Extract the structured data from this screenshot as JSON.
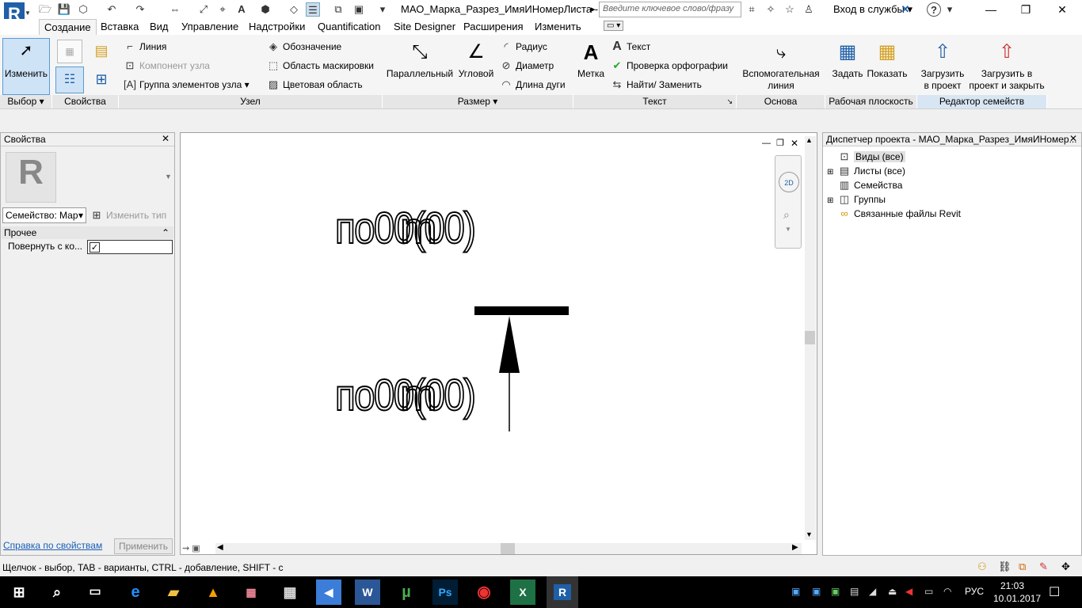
{
  "titlebar": {
    "doc_title": "МАО_Марка_Разрез_ИмяИНомерЛиста -...",
    "search_placeholder": "Введите ключевое слово/фразу",
    "login_label": "Вход в службы"
  },
  "tabs": [
    "Создание",
    "Вставка",
    "Вид",
    "Управление",
    "Надстройки",
    "Quantification",
    "Site Designer",
    "Расширения",
    "Изменить"
  ],
  "ribbon": {
    "modify_label": "Изменить",
    "selection_group": "Выбор",
    "properties_group": "Свойства",
    "node_group": "Узел",
    "line_label": "Линия",
    "node_component_label": "Компонент узла",
    "node_group_label": "Группа элементов узла",
    "symbol_label": "Обозначение",
    "masking_label": "Область маскировки",
    "color_area_label": "Цветовая область",
    "dimension_group": "Размер",
    "parallel_label": "Параллельный",
    "angular_label": "Угловой",
    "radius_label": "Радиус",
    "diameter_label": "Диаметр",
    "arc_length_label": "Длина дуги",
    "text_group": "Текст",
    "tag_label": "Метка",
    "text_label": "Текст",
    "spellcheck_label": "Проверка  орфографии",
    "find_replace_label": "Найти/ Заменить",
    "datum_group": "Основа",
    "ref_line_label": "Вспомогательная линия",
    "workplane_group": "Рабочая плоскость",
    "set_label": "Задать",
    "show_label": "Показать",
    "family_editor_group": "Редактор семейств",
    "load_label": "Загрузить в проект",
    "load_close_label": "Загрузить в проект и закрыть"
  },
  "properties": {
    "title": "Свойства",
    "family_select": "Семейство: Мар",
    "edit_type": "Изменить тип",
    "section_other": "Прочее",
    "rotate_label": "Повернуть с ко...",
    "rotate_checked": true,
    "help_link": "Справка по свойствам",
    "apply_button": "Применить"
  },
  "canvas": {
    "tag_text_top": "по00(00)",
    "tag_text_top_overlay": "m",
    "tag_text_bottom": "по00(00)",
    "tag_text_bottom_overlay": "m"
  },
  "browser": {
    "title": "Диспетчер проекта - МАО_Марка_Разрез_ИмяИНомер...",
    "items": [
      {
        "label": "Виды (все)",
        "expandable": false,
        "selected": true
      },
      {
        "label": "Листы (все)",
        "expandable": true
      },
      {
        "label": "Семейства",
        "expandable": false
      },
      {
        "label": "Группы",
        "expandable": true
      },
      {
        "label": "Связанные файлы Revit",
        "expandable": false
      }
    ]
  },
  "status": {
    "text": "Щелчок - выбор, TAB - варианты, CTRL - добавление, SHIFT - с"
  },
  "taskbar": {
    "lang": "РУС",
    "time": "21:03",
    "date": "10.01.2017"
  }
}
